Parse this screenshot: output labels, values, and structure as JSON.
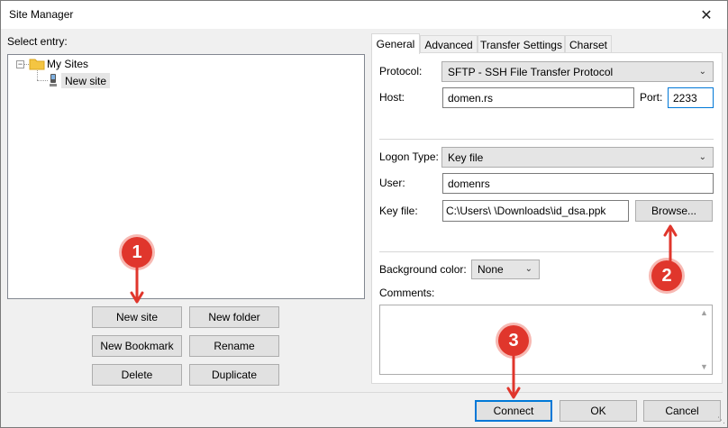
{
  "window": {
    "title": "Site Manager",
    "close_glyph": "✕"
  },
  "left": {
    "select_entry_label": "Select entry:",
    "tree": {
      "root": {
        "label": "My Sites",
        "toggle": "−"
      },
      "child": {
        "label": "New site"
      }
    },
    "buttons": {
      "new_site": "New site",
      "new_folder": "New folder",
      "new_bookmark": "New Bookmark",
      "rename": "Rename",
      "delete": "Delete",
      "duplicate": "Duplicate"
    }
  },
  "tabs": [
    {
      "label": "General",
      "active": true
    },
    {
      "label": "Advanced",
      "active": false
    },
    {
      "label": "Transfer Settings",
      "active": false
    },
    {
      "label": "Charset",
      "active": false
    }
  ],
  "general": {
    "protocol_label": "Protocol:",
    "protocol_value": "SFTP - SSH File Transfer Protocol",
    "host_label": "Host:",
    "host_value": "domen.rs",
    "port_label": "Port:",
    "port_value": "2233",
    "logon_type_label": "Logon Type:",
    "logon_type_value": "Key file",
    "user_label": "User:",
    "user_value": "domenrs",
    "key_file_label": "Key file:",
    "key_file_value": "C:\\Users\\      \\Downloads\\id_dsa.ppk",
    "browse_label": "Browse...",
    "bg_color_label": "Background color:",
    "bg_color_value": "None",
    "comments_label": "Comments:"
  },
  "footer": {
    "connect": "Connect",
    "ok": "OK",
    "cancel": "Cancel"
  },
  "annotations": [
    "1",
    "2",
    "3"
  ],
  "colors": {
    "annotation_red": "#e0362c",
    "accent_blue": "#0078d7",
    "folder_yellow": "#f4c542"
  },
  "icons": {
    "folder": "folder-icon",
    "site": "site-computer-icon",
    "chevron": "chevron-down-icon",
    "arrow": "arrow-icon"
  }
}
